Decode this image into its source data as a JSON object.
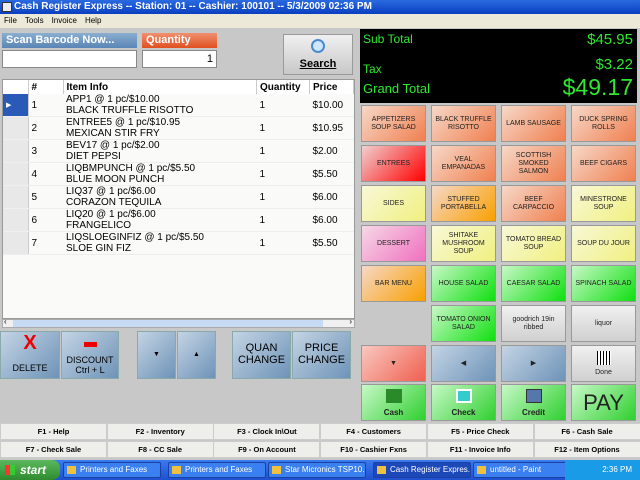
{
  "title": "Cash Register Express -- Station: 01 -- Cashier: 100101 -- 5/3/2009 02:36 PM",
  "menu": [
    "File",
    "Tools",
    "Invoice",
    "Help"
  ],
  "scan": {
    "label": "Scan Barcode Now...",
    "value": ""
  },
  "quantity": {
    "label": "Quantity",
    "value": "1"
  },
  "search_label": "Search",
  "columns": [
    "#",
    "Item Info",
    "Quantity",
    "Price"
  ],
  "rows": [
    {
      "n": "1",
      "l1": "APP1 @ 1 pc/$10.00",
      "l2": "BLACK TRUFFLE RISOTTO",
      "q": "1",
      "p": "$10.00"
    },
    {
      "n": "2",
      "l1": "ENTREE5 @ 1 pc/$10.95",
      "l2": "MEXICAN STIR FRY",
      "q": "1",
      "p": "$10.95"
    },
    {
      "n": "3",
      "l1": "BEV17 @ 1 pc/$2.00",
      "l2": "DIET PEPSI",
      "q": "1",
      "p": "$2.00"
    },
    {
      "n": "4",
      "l1": "LIQBMPUNCH @ 1 pc/$5.50",
      "l2": "BLUE MOON PUNCH",
      "q": "1",
      "p": "$5.50"
    },
    {
      "n": "5",
      "l1": "LIQ37 @ 1 pc/$6.00",
      "l2": "CORAZON TEQUILA",
      "q": "1",
      "p": "$6.00"
    },
    {
      "n": "6",
      "l1": "LIQ20 @ 1 pc/$6.00",
      "l2": "FRANGELICO",
      "q": "1",
      "p": "$6.00"
    },
    {
      "n": "7",
      "l1": "LIQSLOEGINFIZ @ 1 pc/$5.50",
      "l2": "SLOE GIN FIZ",
      "q": "1",
      "p": "$5.50"
    }
  ],
  "actions": {
    "delete": "DELETE",
    "discount": "DISCOUNT",
    "discount_sc": "Ctrl + L",
    "quan1": "QUAN",
    "quan2": "CHANGE",
    "price1": "PRICE",
    "price2": "CHANGE"
  },
  "totals": {
    "sub_label": "Sub Total",
    "sub": "$45.95",
    "tax_label": "Tax",
    "tax": "$3.22",
    "grand_label": "Grand Total",
    "grand": "$49.17"
  },
  "items": [
    [
      "APPETIZERS SOUP SALAD",
      "or"
    ],
    [
      "BLACK TRUFFLE RISOTTO",
      "or"
    ],
    [
      "LAMB SAUSAGE",
      "or"
    ],
    [
      "DUCK SPRING ROLLS",
      "or"
    ],
    [
      "ENTREES",
      "rd"
    ],
    [
      "VEAL EMPANADAS",
      "or"
    ],
    [
      "SCOTTISH SMOKED SALMON",
      "or"
    ],
    [
      "BEEF CIGARS",
      "or"
    ],
    [
      "SIDES",
      "ye"
    ],
    [
      "STUFFED PORTABELLA",
      "bm"
    ],
    [
      "BEEF CARPACCIO",
      "or"
    ],
    [
      "MINESTRONE SOUP",
      "ye"
    ],
    [
      "DESSERT",
      "pk"
    ],
    [
      "SHITAKE MUSHROOM SOUP",
      "ye"
    ],
    [
      "TOMATO BREAD SOUP",
      "ye"
    ],
    [
      "SOUP DU JOUR",
      "ye"
    ],
    [
      "BAR MENU",
      "bm"
    ],
    [
      "HOUSE SALAD",
      "gr"
    ],
    [
      "CAESAR SALAD",
      "gr"
    ],
    [
      "SPINACH SALAD",
      "gr"
    ],
    [
      "",
      "none"
    ],
    [
      "TOMATO ONION SALAD",
      "gr"
    ],
    [
      "goodrich 19in ribbed",
      "gy"
    ],
    [
      "liquor",
      "gy"
    ]
  ],
  "nav": {
    "done": "Done"
  },
  "payments": {
    "cash": "Cash",
    "check": "Check",
    "credit": "Credit",
    "pay": "PAY"
  },
  "fkeys": [
    "F1 - Help",
    "F2 - Inventory",
    "F3 - Clock In\\Out",
    "F4 - Customers",
    "F5 - Price Check",
    "F6 - Cash Sale",
    "F7 - Check Sale",
    "F8 - CC Sale",
    "F9 - On Account",
    "F10 - Cashier Fxns",
    "F11 - Invoice Info",
    "F12 - Item Options"
  ],
  "taskbar": {
    "start": "start",
    "tasks": [
      "Printers and Faxes",
      "Printers and Faxes",
      "Star Micronics TSP10...",
      "Cash Register Expres...",
      "untitled - Paint"
    ],
    "clock": "2:36 PM"
  }
}
